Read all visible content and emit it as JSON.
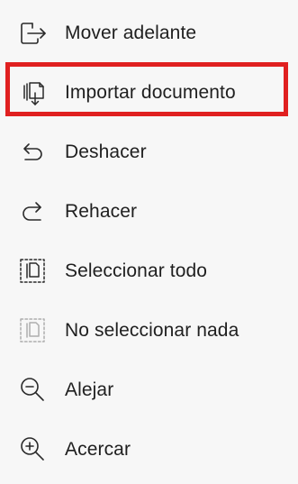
{
  "menu": {
    "items": [
      {
        "label": "Mover adelante",
        "icon": "move-forward-icon"
      },
      {
        "label": "Importar documento",
        "icon": "import-document-icon"
      },
      {
        "label": "Deshacer",
        "icon": "undo-icon"
      },
      {
        "label": "Rehacer",
        "icon": "redo-icon"
      },
      {
        "label": "Seleccionar todo",
        "icon": "select-all-icon"
      },
      {
        "label": "No seleccionar nada",
        "icon": "select-none-icon"
      },
      {
        "label": "Alejar",
        "icon": "zoom-out-icon"
      },
      {
        "label": "Acercar",
        "icon": "zoom-in-icon"
      }
    ]
  },
  "colors": {
    "background": "#f7f7f7",
    "text": "#1f1f1f",
    "highlight": "#e02020"
  }
}
